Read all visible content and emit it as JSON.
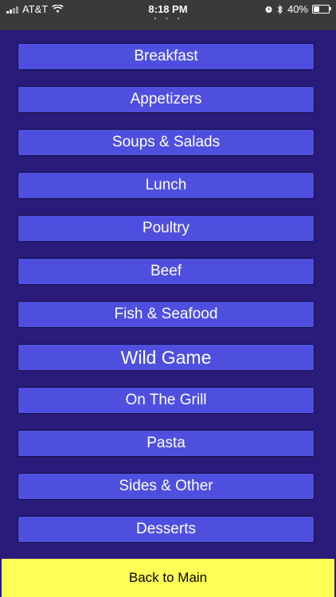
{
  "status_bar": {
    "carrier": "AT&T",
    "time": "8:18 PM",
    "battery": "40%",
    "battery_level": 0.4,
    "icons": [
      "signal-icon",
      "wifi-icon",
      "alarm-icon",
      "bluetooth-icon",
      "battery-icon"
    ]
  },
  "menu": {
    "items": [
      {
        "label": "Breakfast"
      },
      {
        "label": "Appetizers"
      },
      {
        "label": "Soups & Salads"
      },
      {
        "label": "Lunch"
      },
      {
        "label": "Poultry"
      },
      {
        "label": "Beef"
      },
      {
        "label": "Fish & Seafood"
      },
      {
        "label": "Wild Game"
      },
      {
        "label": "On The Grill"
      },
      {
        "label": "Pasta"
      },
      {
        "label": "Sides & Other"
      },
      {
        "label": "Desserts"
      }
    ]
  },
  "footer": {
    "back_label": "Back to Main"
  },
  "colors": {
    "background": "#2a1a7a",
    "button": "#4f4fdf",
    "back_button": "#ffff55"
  }
}
